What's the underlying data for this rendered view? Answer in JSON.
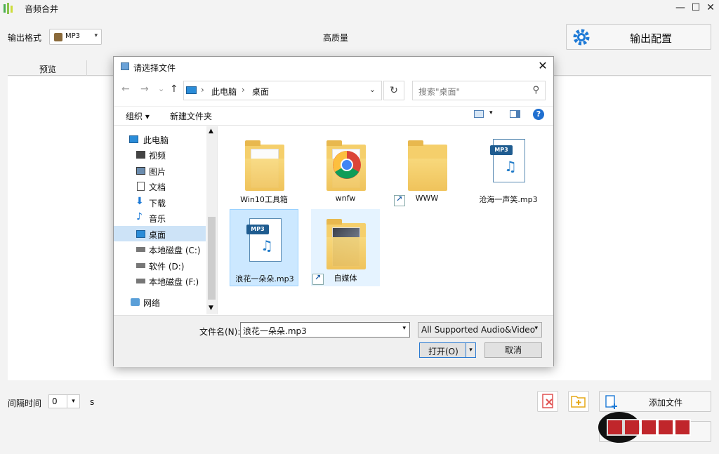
{
  "app": {
    "title": "音频合并",
    "icon": "app-icon",
    "minimize": "—",
    "maximize": "☐",
    "close": "✕"
  },
  "main": {
    "format_label": "输出格式",
    "format_value": "MP3",
    "quality": "高质量",
    "config_button": "输出配置",
    "column_preview": "预览",
    "interval_label": "间隔时间",
    "interval_value": "0",
    "interval_unit": "s",
    "add_file_button": "添加文件",
    "accent": "#1e7ad6"
  },
  "dialog": {
    "title": "请选择文件",
    "close": "✕",
    "nav_back": "←",
    "nav_forward": "→",
    "nav_recent": "⌄",
    "nav_up": "↑",
    "breadcrumb": [
      "此电脑",
      "桌面"
    ],
    "search_placeholder": "搜索\"桌面\"",
    "organize": "组织 ▾",
    "new_folder": "新建文件夹",
    "help": "?",
    "sidebar": [
      {
        "label": "此电脑",
        "icon": "computer-icon"
      },
      {
        "label": "视频",
        "icon": "video-icon"
      },
      {
        "label": "图片",
        "icon": "picture-icon"
      },
      {
        "label": "文档",
        "icon": "document-icon"
      },
      {
        "label": "下载",
        "icon": "download-icon"
      },
      {
        "label": "音乐",
        "icon": "music-icon"
      },
      {
        "label": "桌面",
        "icon": "desktop-icon",
        "selected": true
      },
      {
        "label": "本地磁盘 (C:)",
        "icon": "drive-icon"
      },
      {
        "label": "软件 (D:)",
        "icon": "drive-icon"
      },
      {
        "label": "本地磁盘 (F:)",
        "icon": "drive-icon"
      },
      {
        "label": "网络",
        "icon": "network-icon"
      }
    ],
    "files": [
      {
        "name": "Win10工具箱",
        "type": "folder"
      },
      {
        "name": "wnfw",
        "type": "folder-chrome"
      },
      {
        "name": "WWW",
        "type": "folder-shortcut"
      },
      {
        "name": "沧海一声笑.mp3",
        "type": "mp3"
      },
      {
        "name": "浪花一朵朵.mp3",
        "type": "mp3",
        "selected": true
      },
      {
        "name": "自媒体",
        "type": "folder-shortcut",
        "hover": true
      }
    ],
    "filename_label": "文件名(N):",
    "filename_value": "浪花一朵朵.mp3",
    "filter_value": "All Supported Audio&Video",
    "open_button": "打开(O)",
    "cancel_button": "取消",
    "dropdown": "▾"
  }
}
